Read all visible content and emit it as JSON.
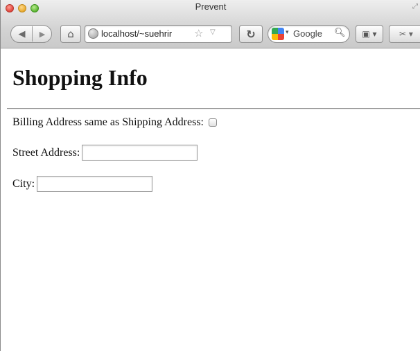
{
  "window": {
    "title": "Prevent"
  },
  "toolbar": {
    "url": "localhost/~suehrir",
    "search_engine": "Google"
  },
  "page": {
    "heading": "Shopping Info",
    "billing_label": "Billing Address same as Shipping Address:",
    "billing_checked": false,
    "street_label": "Street Address:",
    "street_value": "",
    "city_label": "City:",
    "city_value": ""
  },
  "icons": {
    "back": "back-arrow-icon",
    "forward": "forward-arrow-icon",
    "home": "home-icon",
    "site": "globe-icon",
    "bookmark_star": "star-icon",
    "reload": "reload-icon",
    "search_engine": "google-icon",
    "search": "magnifier-icon",
    "bookmarks_menu": "bookmark-icon",
    "extension": "extension-icon"
  }
}
